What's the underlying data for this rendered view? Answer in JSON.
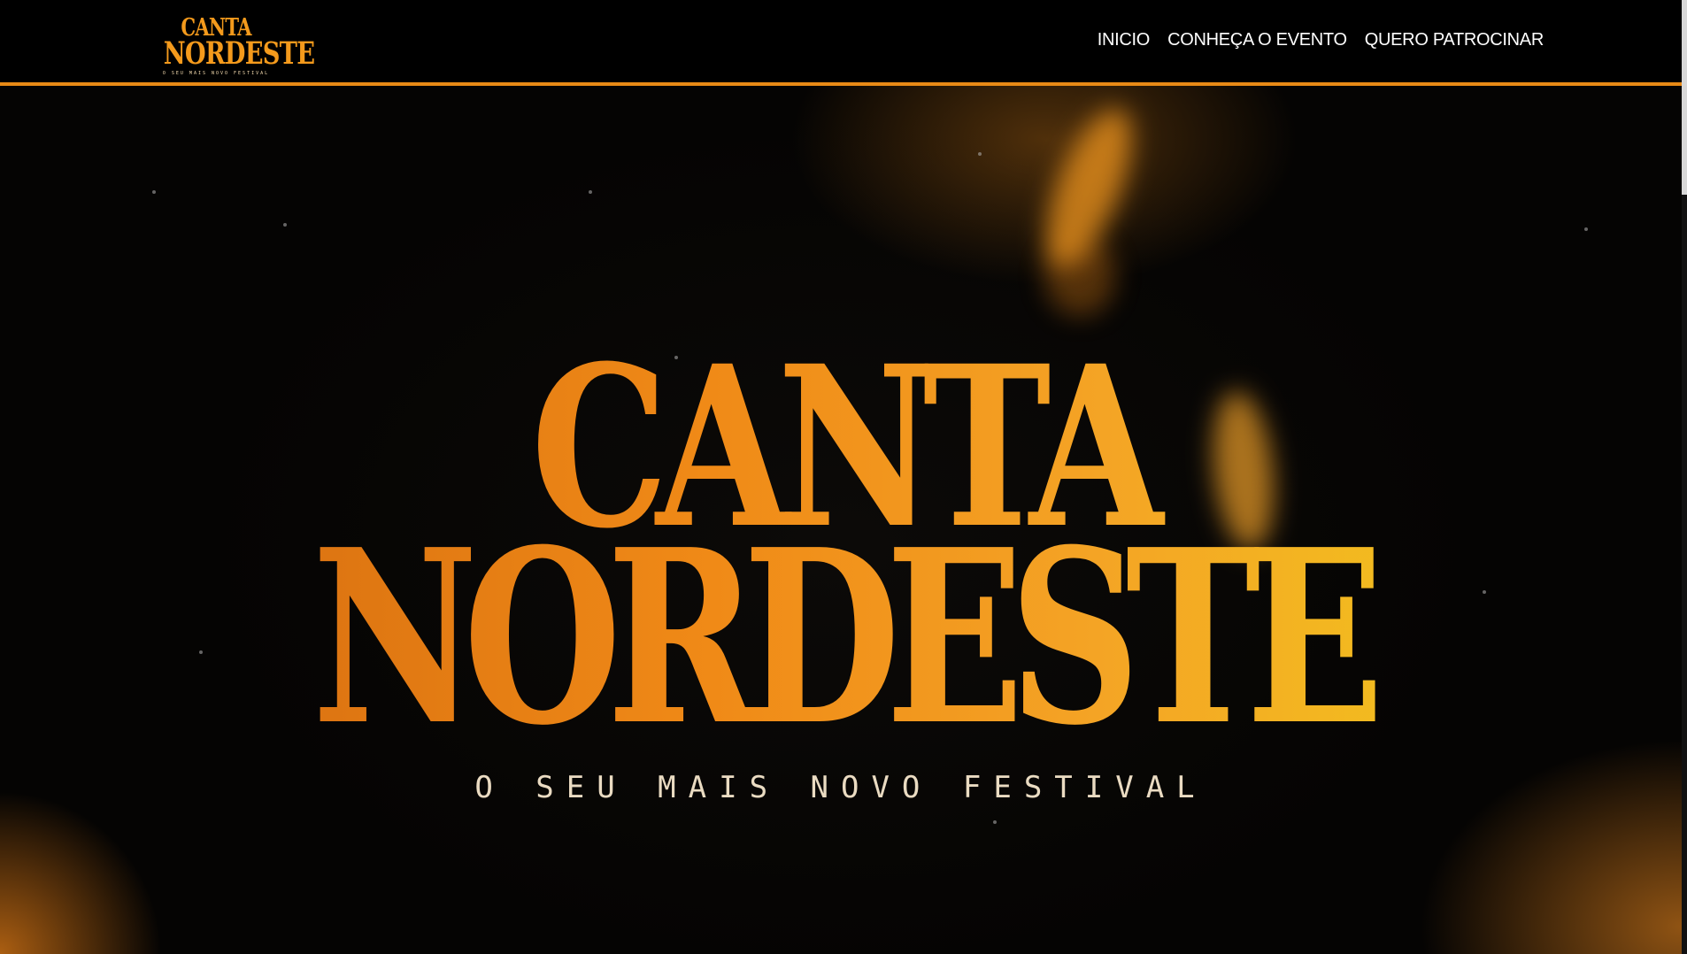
{
  "header": {
    "logo": {
      "line1": "CANTA",
      "line2": "NORDESTE",
      "line3": "O SEU MAIS NOVO FESTIVAL"
    },
    "nav": [
      "INICIO",
      "CONHEÇA O EVENTO",
      "QUERO PATROCINAR"
    ]
  },
  "hero": {
    "title_line1": "CANTA",
    "title_line2": "NORDESTE",
    "tagline": "O SEU MAIS NOVO FESTIVAL"
  },
  "colors": {
    "accent": "#e88a16",
    "background": "#000000",
    "tagline": "#eadbc2"
  }
}
